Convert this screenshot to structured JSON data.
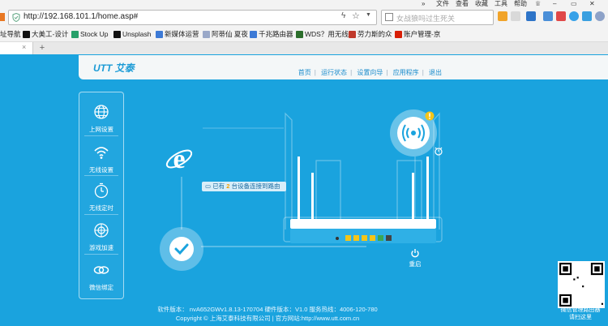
{
  "browser": {
    "menu": [
      "文件",
      "查看",
      "收藏",
      "工具",
      "帮助"
    ],
    "address_url": "http://192.168.101.1/home.asp#",
    "search_placeholder": "女战狼吗过生死关",
    "bookmarks": [
      {
        "label": "址导航",
        "icon": "nav-icon",
        "color": "#e04f2a"
      },
      {
        "label": "大美工-设计",
        "icon": "dameigong-icon",
        "color": "#111111"
      },
      {
        "label": "Stock Up",
        "icon": "stockup-icon",
        "color": "#27a06a"
      },
      {
        "label": "Unsplash",
        "icon": "camera-icon",
        "color": "#111111"
      },
      {
        "label": "新媒体运营",
        "icon": "bookmark-30-icon",
        "color": "#3d7ad6"
      },
      {
        "label": "阿蒂仙 夏夜",
        "icon": "bookmark-page-icon",
        "color": "#9aa8c8"
      },
      {
        "label": "千兆路由器",
        "icon": "bookmark-30-icon",
        "color": "#3d7ad6"
      },
      {
        "label": "WDS？用无线",
        "icon": "wds-icon",
        "color": "#2c6e2c"
      },
      {
        "label": "劳力斯的众",
        "icon": "laolisi-icon",
        "color": "#c0392b"
      },
      {
        "label": "账户管理-京",
        "icon": "jd-icon",
        "color": "#d81e06"
      }
    ],
    "newtab_symbol": "+",
    "tab_close": "×"
  },
  "header": {
    "logo_text": "UTT 艾泰",
    "nav": [
      "首页",
      "运行状态",
      "设置向导",
      "应用程序",
      "退出"
    ]
  },
  "sidebar": {
    "items": [
      {
        "label": "上网设置",
        "icon": "globe-icon"
      },
      {
        "label": "无线设置",
        "icon": "wifi-icon"
      },
      {
        "label": "无线定时",
        "icon": "timer-icon"
      },
      {
        "label": "游戏加速",
        "icon": "game-icon"
      },
      {
        "label": "微信绑定",
        "icon": "wechat-link-icon"
      }
    ]
  },
  "status": {
    "prefix": "已有",
    "count": "2",
    "suffix": "台设备连接到路由"
  },
  "reboot_label": "重启",
  "footer": {
    "line1": "软件版本： nvA652GWv1.8.13-170704  硬件版本：V1.0   服务热线：4006-120-780",
    "line2": "Copyright © 上海艾泰科技有限公司   | 官方网站:http://www.utt.com.cn"
  },
  "qr_caption": {
    "line1": "微信管理路由器",
    "line2": "请扫这里"
  },
  "colors": {
    "page_bg": "#1aa3de",
    "header_bg": "#f4f7f8",
    "accent": "#1b9bd6",
    "warning": "#f5c518"
  }
}
